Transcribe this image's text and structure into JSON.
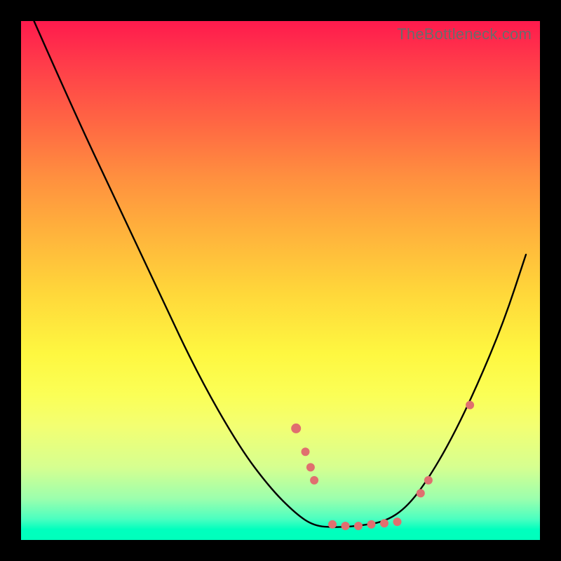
{
  "watermark": "TheBottleneck.com",
  "colors": {
    "bead": "#e06f6f",
    "curve": "#000000",
    "frame_bg_top": "#ff1a4d",
    "frame_bg_bottom": "#00ffbc",
    "page_bg": "#000000"
  },
  "chart_data": {
    "type": "line",
    "title": "",
    "xlabel": "",
    "ylabel": "",
    "xlim": [
      0,
      100
    ],
    "ylim": [
      0,
      100
    ],
    "note": "No numeric axes or tick labels are rendered. x/y are in percent of the plot-frame width/height, measured from the top-left of the gradient frame (y increases downward). The curve is a bottleneck V shape; beads are highlighted sample points along the curve.",
    "series": [
      {
        "name": "bottleneck-curve",
        "x": [
          2.5,
          10,
          18,
          26,
          34,
          42,
          48,
          53,
          56.5,
          60.5,
          65,
          70,
          74,
          78,
          83,
          88,
          93,
          97.3
        ],
        "y": [
          0,
          17,
          34,
          51,
          68,
          82,
          90,
          95,
          97.3,
          97.6,
          97.3,
          96.5,
          94,
          89,
          80.5,
          70,
          58,
          45
        ]
      }
    ],
    "beads": [
      {
        "x": 53.0,
        "y": 78.5,
        "r": 7
      },
      {
        "x": 54.8,
        "y": 83.0,
        "r": 6
      },
      {
        "x": 55.8,
        "y": 86.0,
        "r": 6
      },
      {
        "x": 56.5,
        "y": 88.5,
        "r": 6
      },
      {
        "x": 60.0,
        "y": 97.0,
        "r": 6
      },
      {
        "x": 62.5,
        "y": 97.3,
        "r": 6
      },
      {
        "x": 65.0,
        "y": 97.3,
        "r": 6
      },
      {
        "x": 67.5,
        "y": 97.0,
        "r": 6
      },
      {
        "x": 70.0,
        "y": 96.8,
        "r": 6
      },
      {
        "x": 72.5,
        "y": 96.5,
        "r": 6
      },
      {
        "x": 77.0,
        "y": 91.0,
        "r": 6
      },
      {
        "x": 78.5,
        "y": 88.5,
        "r": 6
      },
      {
        "x": 86.5,
        "y": 74.0,
        "r": 6
      }
    ]
  }
}
